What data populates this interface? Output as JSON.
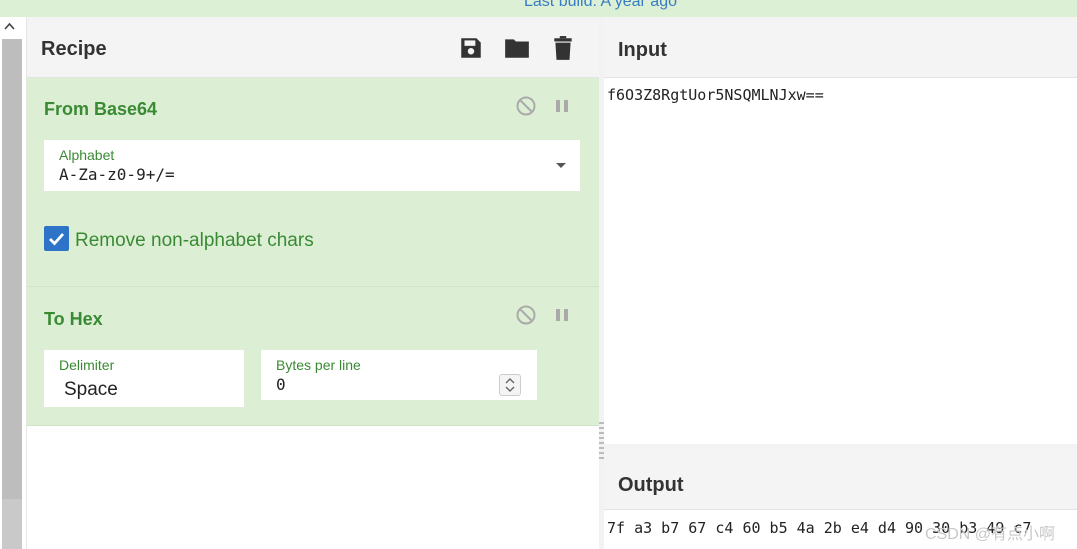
{
  "banner": {
    "text": "Last build: A year ago"
  },
  "recipe": {
    "title": "Recipe",
    "toolbar": {
      "save_icon": "save-icon",
      "open_icon": "folder-icon",
      "clear_icon": "trash-icon"
    },
    "operations": [
      {
        "name": "From Base64",
        "alphabet_label": "Alphabet",
        "alphabet_value": "A-Za-z0-9+/=",
        "remove_label": "Remove non-alphabet chars",
        "remove_checked": true
      },
      {
        "name": "To Hex",
        "delimiter_label": "Delimiter",
        "delimiter_value": "Space",
        "bytes_label": "Bytes per line",
        "bytes_value": "0"
      }
    ]
  },
  "input": {
    "title": "Input",
    "text": "f6O3Z8RgtUor5NSQMLNJxw=="
  },
  "output": {
    "title": "Output",
    "text": "7f a3 b7 67 c4 60 b5 4a 2b e4 d4 90 30 b3 49 c7"
  },
  "watermark": {
    "text": "CSDN @有点小啊"
  },
  "colors": {
    "accent": "#3a8a33",
    "banner": "#dbf0d5",
    "op_bg": "#dcefd5",
    "checkbox": "#2d74c9"
  }
}
